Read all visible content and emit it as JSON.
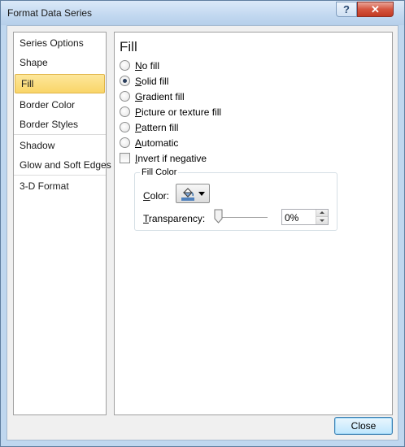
{
  "window": {
    "title": "Format Data Series",
    "help": "?",
    "close_glyph": "✕"
  },
  "nav": {
    "items": [
      {
        "label": "Series Options"
      },
      {
        "label": "Shape"
      },
      {
        "label": "Fill"
      },
      {
        "label": "Border Color"
      },
      {
        "label": "Border Styles"
      },
      {
        "label": "Shadow"
      },
      {
        "label": "Glow and Soft Edges"
      },
      {
        "label": "3-D Format"
      }
    ],
    "selected": "Fill"
  },
  "fill": {
    "title": "Fill",
    "options": [
      {
        "key": "N",
        "rest": "o fill",
        "checked": false
      },
      {
        "key": "S",
        "rest": "olid fill",
        "checked": true
      },
      {
        "key": "G",
        "rest": "radient fill",
        "checked": false
      },
      {
        "key": "P",
        "rest": "icture or texture fill",
        "checked": false
      },
      {
        "key": "P",
        "rest": "attern fill",
        "checked": false
      },
      {
        "key": "A",
        "rest": "utomatic",
        "checked": false
      }
    ],
    "invert": {
      "key": "I",
      "rest": "nvert if negative",
      "checked": false
    },
    "fill_color": {
      "group_title": "Fill Color",
      "color_key": "C",
      "color_rest": "olor:",
      "color_icon": "paint-bucket-icon",
      "color_value": "#4f81bd",
      "transparency_key": "T",
      "transparency_rest": "ransparency:",
      "transparency_value": "0%",
      "transparency_fraction": 0
    }
  },
  "footer": {
    "close_label": "Close"
  }
}
